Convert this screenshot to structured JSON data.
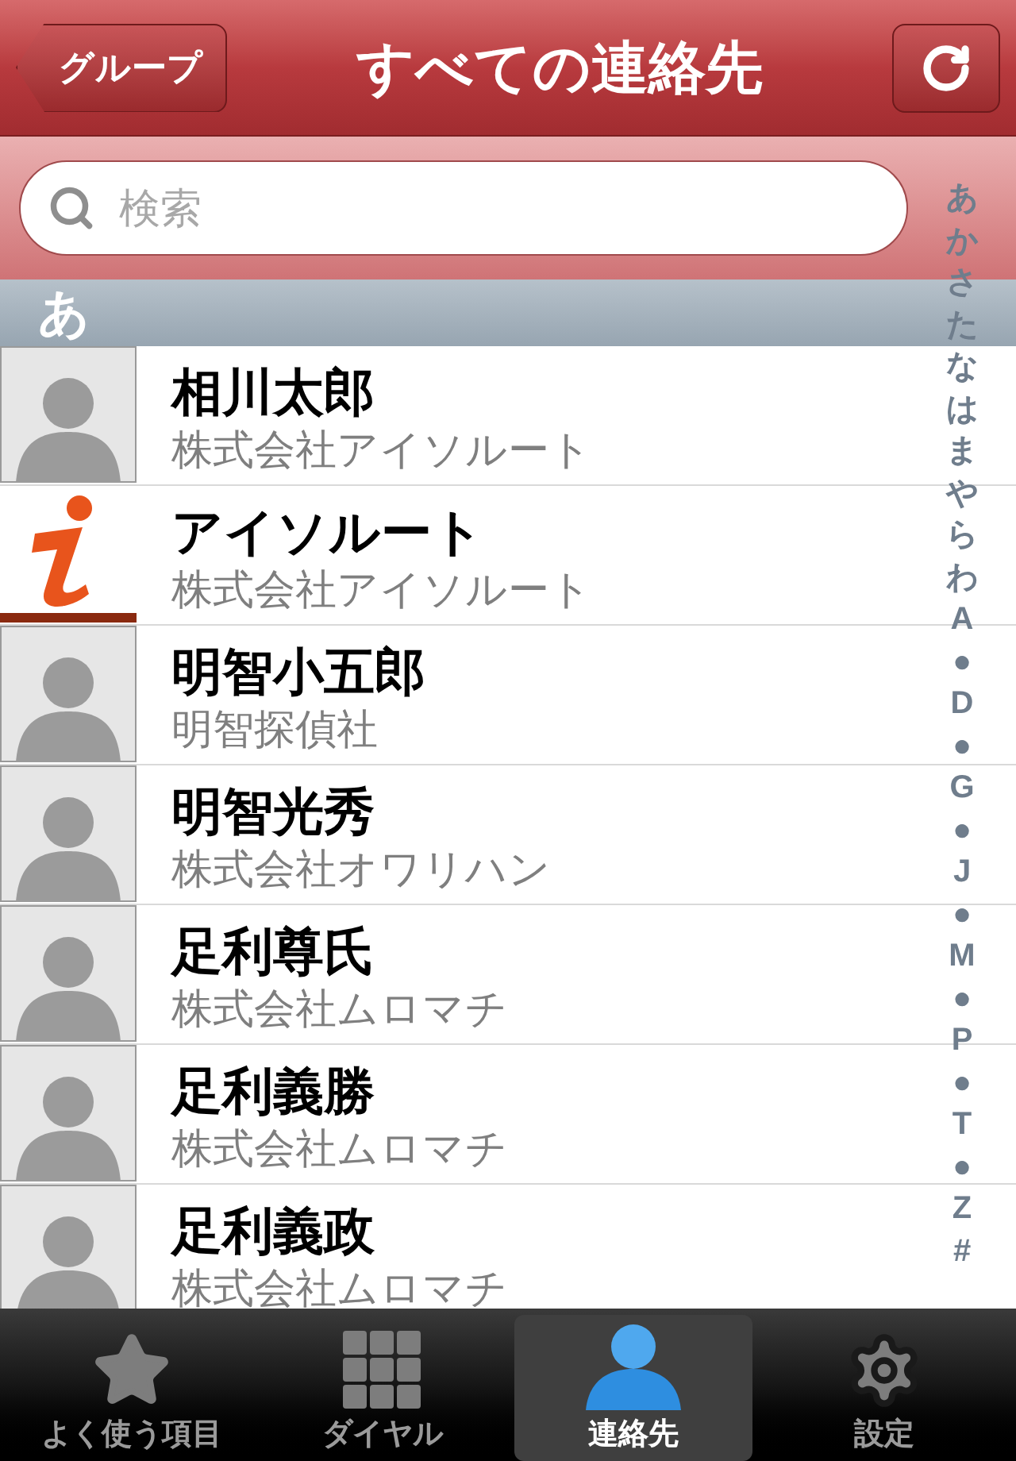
{
  "nav_bar": {
    "back_button": "グループ",
    "title": "すべての連絡先"
  },
  "search": {
    "placeholder": "検索"
  },
  "index": [
    "あ",
    "か",
    "さ",
    "た",
    "な",
    "は",
    "ま",
    "や",
    "ら",
    "わ",
    "A",
    "●",
    "D",
    "●",
    "G",
    "●",
    "J",
    "●",
    "M",
    "●",
    "P",
    "●",
    "T",
    "●",
    "Z",
    "#"
  ],
  "sections": [
    {
      "header": "あ",
      "contacts": [
        {
          "name": "相川太郎",
          "company": "株式会社アイソルート",
          "kind": "silhouette"
        },
        {
          "name": "アイソルート",
          "company": "株式会社アイソルート",
          "kind": "logo"
        },
        {
          "name": "明智小五郎",
          "company": "明智探偵社",
          "kind": "silhouette"
        },
        {
          "name": "明智光秀",
          "company": "株式会社オワリハン",
          "kind": "silhouette"
        },
        {
          "name": "足利尊氏",
          "company": "株式会社ムロマチ",
          "kind": "silhouette"
        },
        {
          "name": "足利義勝",
          "company": "株式会社ムロマチ",
          "kind": "silhouette"
        },
        {
          "name": "足利義政",
          "company": "株式会社ムロマチ",
          "kind": "silhouette"
        }
      ]
    }
  ],
  "tab_bar": [
    {
      "label": "よく使う項目",
      "kind": "star",
      "selected": false
    },
    {
      "label": "ダイヤル",
      "kind": "keypad",
      "selected": false
    },
    {
      "label": "連絡先",
      "kind": "person",
      "selected": true
    },
    {
      "label": "設定",
      "kind": "gear",
      "selected": false
    }
  ]
}
